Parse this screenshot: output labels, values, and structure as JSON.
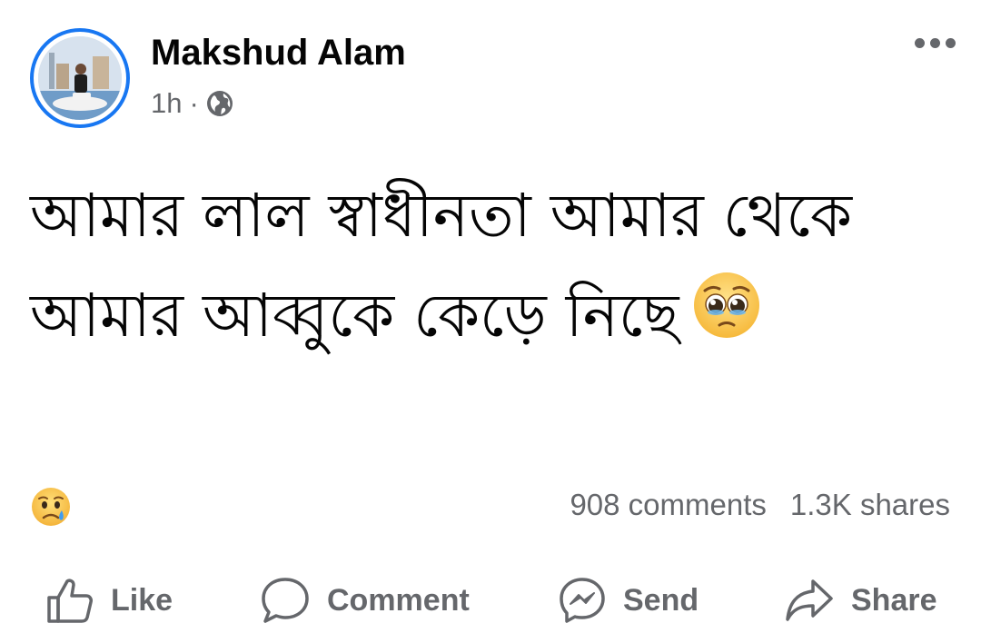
{
  "post": {
    "author": "Makshud Alam",
    "time": "1h",
    "separator": "·",
    "privacy_icon": "globe-icon",
    "text": "আমার লাল স্বাধীনতা আমার থেকে আমার আব্বুকে কেড়ে নিছে",
    "text_emoji": "pleading-face"
  },
  "reactions": {
    "icon": "sad-face"
  },
  "stats": {
    "comments": "908 comments",
    "shares": "1.3K shares"
  },
  "actions": {
    "like": "Like",
    "comment": "Comment",
    "send": "Send",
    "share": "Share"
  },
  "colors": {
    "accent": "#1877f2",
    "text": "#050505",
    "secondary": "#65676b"
  }
}
